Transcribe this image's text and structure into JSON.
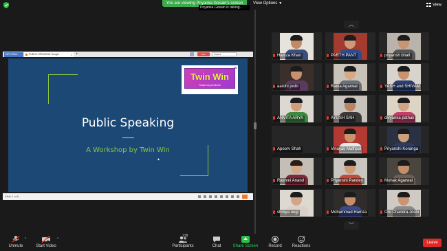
{
  "topbar": {
    "share_banner": "You are viewing Priyanka Gosain's screen",
    "view_options": "View Options",
    "talking": "Priyanka Gosain is talking...",
    "view_button": "View"
  },
  "shared_screen": {
    "browser": {
      "tab1": "MPS Office",
      "tab2": "PUBLIC SPEAKING Google",
      "rec_button": "Rec",
      "present_button": "Present"
    },
    "slide": {
      "logo_text": "Twin Win",
      "logo_tagline": "Reach beyond limits",
      "logo_tm": "TM",
      "title": "Public Speaking",
      "subtitle": "A Workshop by Twin Win",
      "slide_counter": "Slide 1 of 6"
    }
  },
  "gallery": {
    "participants": [
      {
        "name": "Hamza Khan",
        "bg": "#e6e2dc",
        "shirt": "#3b4f7a",
        "hair": "#1c1c1c",
        "skin": "#c18a63"
      },
      {
        "name": "PARTH PANT",
        "bg": "#a33b2f",
        "shirt": "#2f4b8a",
        "hair": "#1c1c1c",
        "skin": "#d09a7a"
      },
      {
        "name": "priyansh bhatt",
        "bg": "#b9b3ab",
        "shirt": "#555555",
        "hair": "#1c1c1c",
        "skin": "#c69572"
      },
      {
        "name": "aarohi joshi",
        "bg": "#3a2f2a",
        "shirt": "#5b3a5f",
        "hair": "#1c1c1c",
        "skin": "#c9906c"
      },
      {
        "name": "Raina Agarwal",
        "bg": "#c9c3ba",
        "shirt": "#6b6f77",
        "hair": "#1c1c1c",
        "skin": "#d6a987"
      },
      {
        "name": "YASH and SHIVAM",
        "bg": "#d8d3cc",
        "shirt": "#2b3f73",
        "hair": "#1c1c1c",
        "skin": "#c8946e"
      },
      {
        "name": "ANVITA ARYA",
        "bg": "#ddd9d2",
        "shirt": "#3e8a3f",
        "hair": "#1c1c1c",
        "skin": "#cf9d79"
      },
      {
        "name": "AYUSH SAH",
        "bg": "#c8c4bd",
        "shirt": "#3a3a3a",
        "hair": "#1c1c1c",
        "skin": "#b88463"
      },
      {
        "name": "divyanka pathak",
        "bg": "#dcd4c4",
        "shirt": "#c23f6a",
        "hair": "#1c1c1c",
        "skin": "#d2a486"
      },
      {
        "name": "Apoorv   Shah",
        "bg": "#262626",
        "shirt": "#262626",
        "hair": "#262626",
        "skin": "#262626"
      },
      {
        "name": "Vinayak Mathpal",
        "bg": "#b23a32",
        "shirt": "#e8e8e8",
        "hair": "#1c1c1c",
        "skin": "#c8936e"
      },
      {
        "name": "Priyanshi Koranga",
        "bg": "#2a3142",
        "shirt": "#2d3b63",
        "hair": "#1c1c1c",
        "skin": "#caa07f"
      },
      {
        "name": "Rashmi Anand",
        "bg": "#c4beb6",
        "shirt": "#7a2b3a",
        "hair": "#2a1d16",
        "skin": "#d4a98a"
      },
      {
        "name": "Priyanshi Pandey",
        "bg": "#c9c6c0",
        "shirt": "#c44a3a",
        "hair": "#1c1c1c",
        "skin": "#cf9b76"
      },
      {
        "name": "Mohak   Agarwal",
        "bg": "#4b4540",
        "shirt": "#6b5e55",
        "hair": "#1c1c1c",
        "skin": "#c38e6b"
      },
      {
        "name": "shreya negi",
        "bg": "#ddd8d0",
        "shirt": "#d9d0c7",
        "hair": "#1c1c1c",
        "skin": "#d4a689"
      },
      {
        "name": "Mohammad Hamza",
        "bg": "#2f2c2a",
        "shirt": "#3a4a8a",
        "hair": "#1c1c1c",
        "skin": "#c48f6b"
      },
      {
        "name": "Om Chandra Joshi",
        "bg": "#cfcac3",
        "shirt": "#8b8b8b",
        "hair": "#1c1c1c",
        "skin": "#c99671"
      }
    ]
  },
  "toolbar": {
    "unmute": "Unmute",
    "start_video": "Start Video",
    "participants": "Participants",
    "participants_count": "138",
    "chat": "Chat",
    "share_screen": "Share Screen",
    "record": "Record",
    "reactions": "Reactions",
    "leave": "Leave"
  }
}
